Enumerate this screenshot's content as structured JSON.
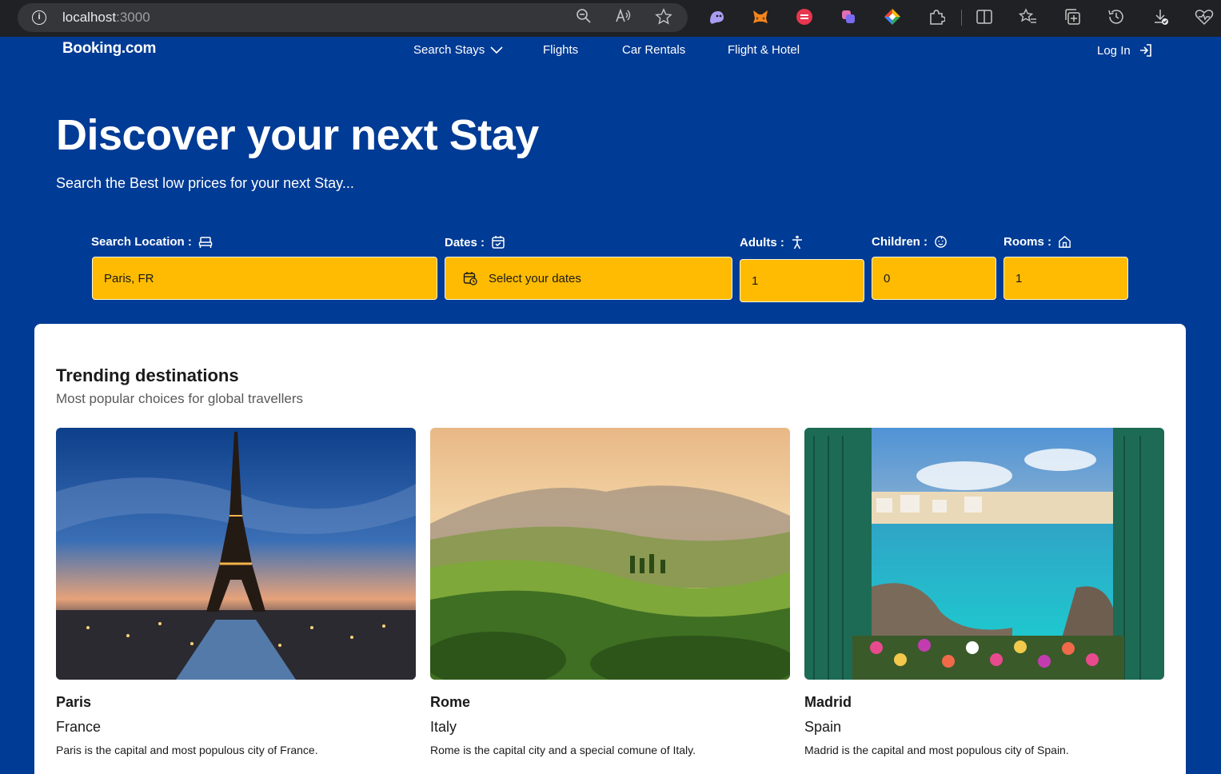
{
  "browser": {
    "url_host": "localhost",
    "url_port": ":3000"
  },
  "header": {
    "logo": "Booking.com",
    "nav": [
      {
        "label": "Search Stays"
      },
      {
        "label": "Flights"
      },
      {
        "label": "Car Rentals"
      },
      {
        "label": "Flight & Hotel"
      }
    ],
    "login_label": "Log In"
  },
  "hero": {
    "title": "Discover your next Stay",
    "subtitle": "Search the Best low prices for your next Stay..."
  },
  "search": {
    "location_label": "Search Location :",
    "location_value": "Paris, FR",
    "dates_label": "Dates :",
    "dates_placeholder": "Select your dates",
    "adults_label": "Adults :",
    "adults_value": "1",
    "children_label": "Children :",
    "children_value": "0",
    "rooms_label": "Rooms :",
    "rooms_value": "1"
  },
  "trending": {
    "title": "Trending destinations",
    "subtitle": "Most popular choices for global travellers",
    "items": [
      {
        "name": "Paris",
        "country": "France",
        "description": "Paris is the capital and most populous city of France."
      },
      {
        "name": "Rome",
        "country": "Italy",
        "description": "Rome is the capital city and a special comune of Italy."
      },
      {
        "name": "Madrid",
        "country": "Spain",
        "description": "Madrid is the capital and most populous city of Spain."
      }
    ]
  },
  "colors": {
    "brand_blue": "#003b95",
    "accent_yellow": "#febb02"
  }
}
